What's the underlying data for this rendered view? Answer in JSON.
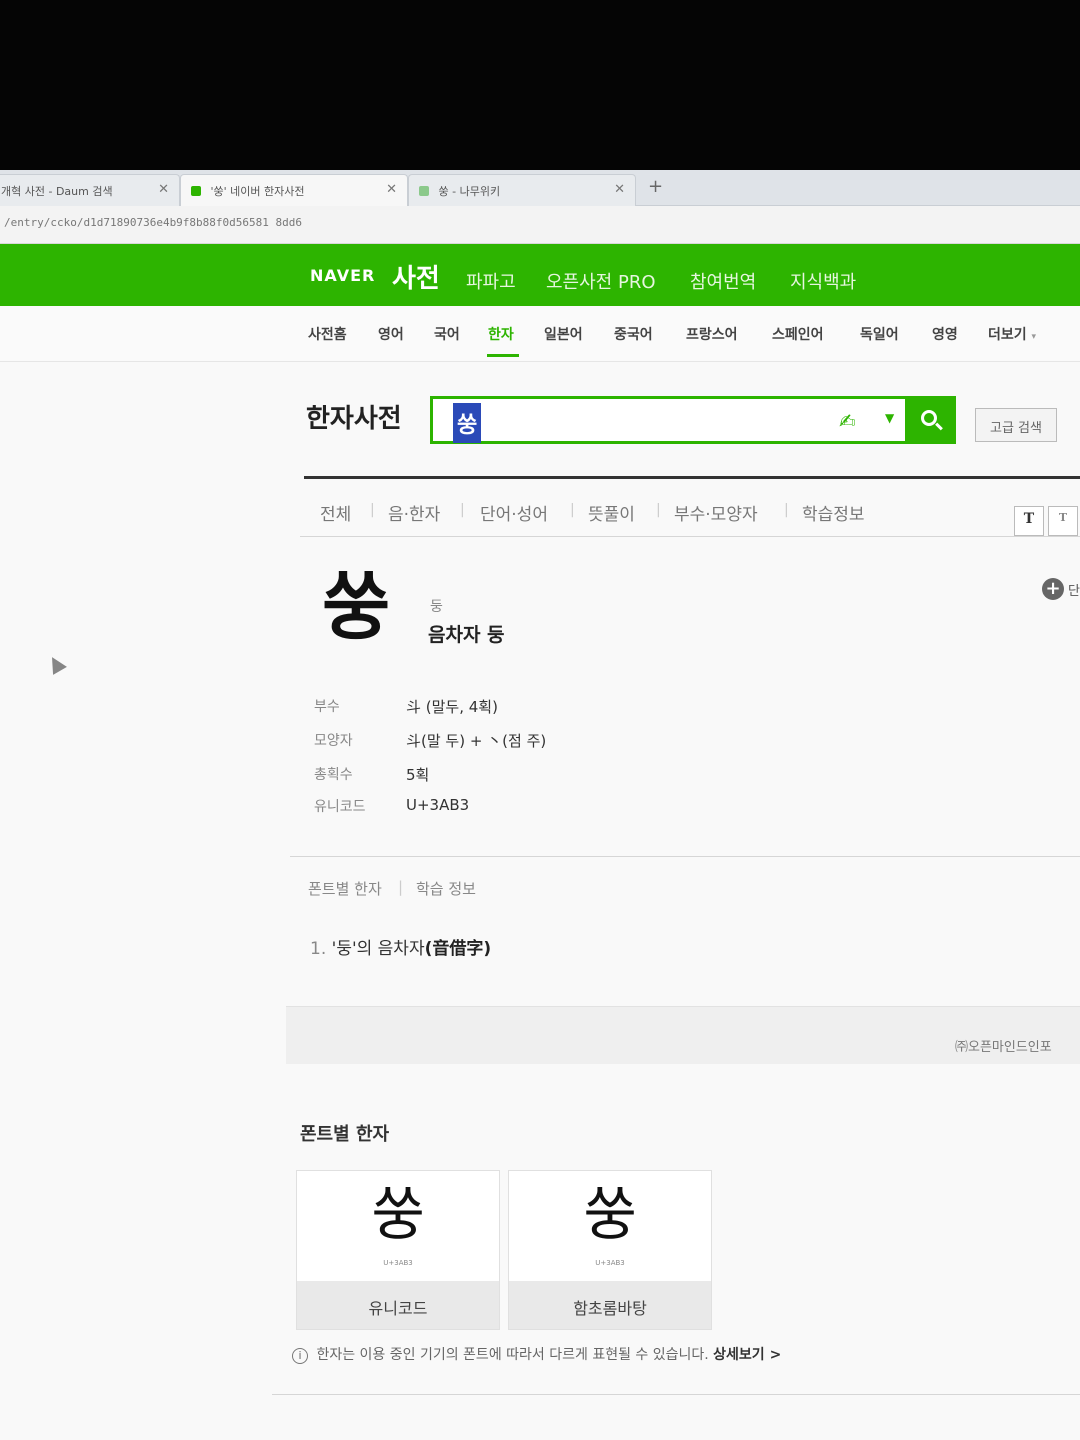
{
  "browser": {
    "tabs": [
      {
        "title": "개혁 사전 - Daum 검색"
      },
      {
        "title": "'쑹' 네이버 한자사전"
      },
      {
        "title": "쑹 - 나무위키"
      }
    ],
    "close_glyph": "✕",
    "new_tab": "+",
    "url": "/entry/ccko/d1d71890736e4b9f8b88f0d56581 8dd6"
  },
  "gnb": {
    "logo": "NAVER",
    "dict": "사전",
    "links": [
      "파파고",
      "오픈사전 PRO",
      "참여번역",
      "지식백과"
    ]
  },
  "lnb": {
    "items": [
      "사전홈",
      "영어",
      "국어",
      "한자",
      "일본어",
      "중국어",
      "프랑스어",
      "스페인어",
      "독일어",
      "영영",
      "더보기"
    ],
    "active": "한자",
    "more_caret": "▾"
  },
  "search": {
    "title": "한자사전",
    "query": "쑹",
    "handwriting_icon": "handwriting-icon",
    "advanced": "고급 검색"
  },
  "filters": [
    "전체",
    "음·한자",
    "단어·성어",
    "뜻풀이",
    "부수·모양자",
    "학습정보"
  ],
  "size_buttons": [
    "T",
    "T"
  ],
  "entry": {
    "glyph": "쑹",
    "reading_small": "둥",
    "reading_main": "음차자 둥",
    "more_label": "단",
    "info": [
      {
        "label": "부수",
        "value": "斗 (말두, 4획)"
      },
      {
        "label": "모양자",
        "value": "斗(말 두) + 丶(점 주)"
      },
      {
        "label": "총획수",
        "value": "5획"
      },
      {
        "label": "유니코드",
        "value": "U+3AB3"
      }
    ],
    "subtabs": [
      "폰트별 한자",
      "학습 정보"
    ],
    "meaning_num": "1.",
    "meaning_text": "'둥'의 음차자",
    "meaning_hanja": "(音借字)",
    "provider": "㈜오픈마인드인포"
  },
  "fonts": {
    "title": "폰트별 한자",
    "cards": [
      {
        "glyph": "쑹",
        "code": "U+3AB3",
        "caption": "유니코드"
      },
      {
        "glyph": "쑹",
        "code": "U+3AB3",
        "caption": "함초롬바탕"
      }
    ],
    "notice": "한자는 이용 중인 기기의 폰트에 따라서 다르게 표현될 수 있습니다.",
    "notice_link": "상세보기 >"
  }
}
